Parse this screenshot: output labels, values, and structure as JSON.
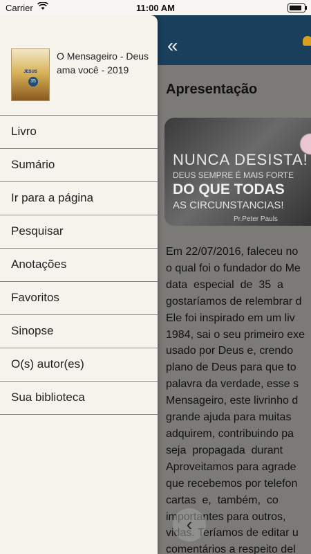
{
  "status": {
    "carrier": "Carrier",
    "time": "11:00 AM"
  },
  "reader": {
    "title": "Apresentação",
    "banner": {
      "line1": "NUNCA DESISTA!",
      "line2": "DEUS SEMPRE É MAIS FORTE",
      "line3": "DO QUE TODAS",
      "line4": "AS CIRCUNSTANCIAS!",
      "signature": "Pr.Peter Pauls"
    },
    "body_lines": [
      "Em 22/07/2016, faleceu no",
      "o qual foi o fundador do Me",
      "data  especial  de  35  a",
      "gostaríamos de relembrar d",
      "Ele foi inspirado em um liv",
      "1984, sai o seu primeiro exe",
      "usado por Deus e, crendo",
      "plano de Deus para que to",
      "palavra da verdade, esse s",
      "Mensageiro, este livrinho d",
      "grande ajuda para muitas",
      "adquirem, contribuindo pa",
      "seja  propagada  durant",
      "Aproveitamos para agrade",
      "que recebemos por telefon",
      "cartas  e,  também,  co",
      "importantes para outros,",
      "vidas. Teríamos de editar u",
      "comentários a respeito del"
    ]
  },
  "drawer": {
    "book_title": "O Mensageiro - Deus ama você - 2019",
    "cover_word": "JESUS",
    "cover_badge": "35",
    "items": [
      {
        "label": "Livro"
      },
      {
        "label": "Sumário"
      },
      {
        "label": "Ir para a página"
      },
      {
        "label": "Pesquisar"
      },
      {
        "label": "Anotações"
      },
      {
        "label": "Favoritos"
      },
      {
        "label": "Sinopse"
      },
      {
        "label": "O(s) autor(es)"
      },
      {
        "label": "Sua biblioteca"
      }
    ]
  },
  "icons": {
    "back": "double-chevron-left-icon",
    "prev": "chevron-left-icon",
    "notification": "bell-icon"
  },
  "colors": {
    "topbar": "#1a3f5c",
    "drawer_bg": "#f5f3ec",
    "reader_overlay": "#7b7a77"
  }
}
